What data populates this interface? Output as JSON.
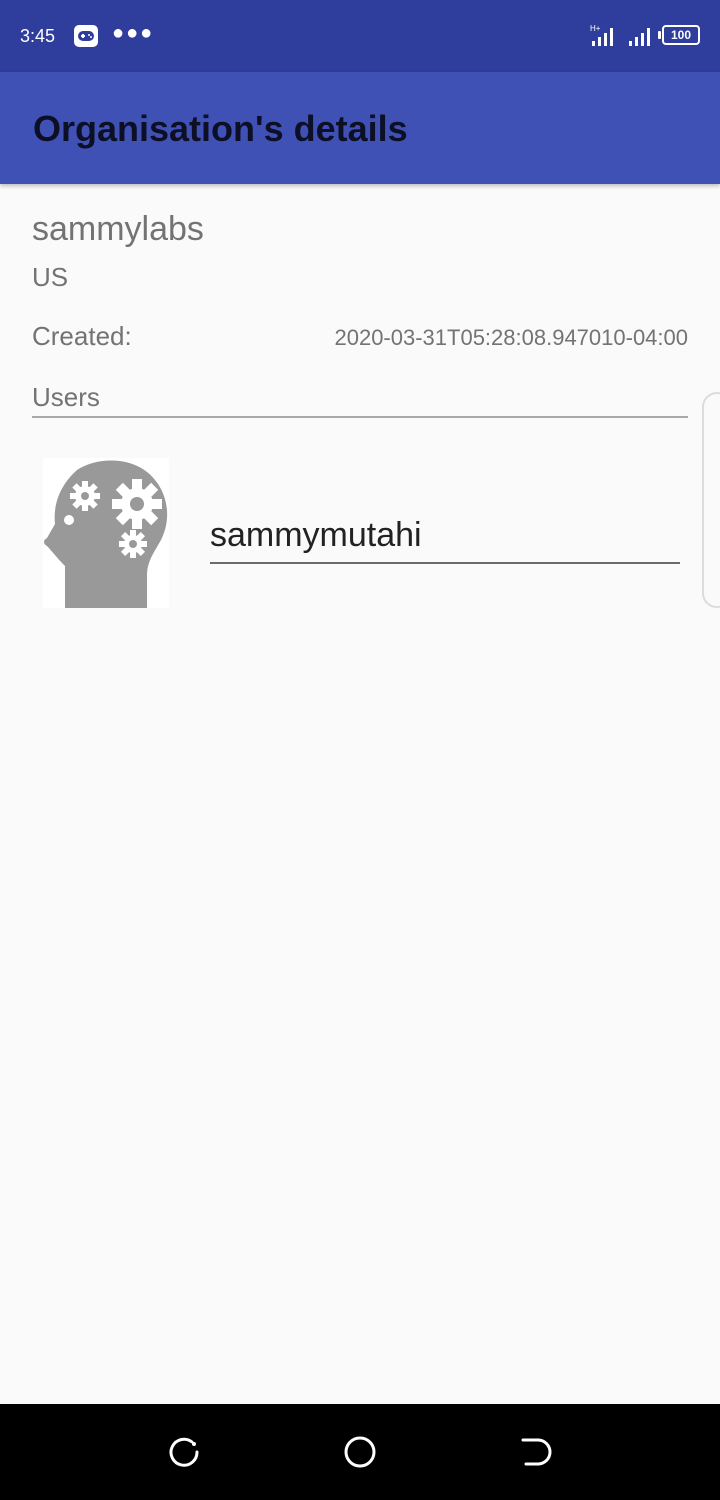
{
  "status_bar": {
    "time": "3:45",
    "battery": "100",
    "icons": [
      "game-icon",
      "more-dots",
      "signal-icon",
      "battery-icon"
    ]
  },
  "app_bar": {
    "title": "Organisation's details"
  },
  "organisation": {
    "name": "sammylabs",
    "country": "US",
    "created_label": "Created:",
    "created_value": "2020-03-31T05:28:08.947010-04:00"
  },
  "users": {
    "label": "Users",
    "items": [
      {
        "username": "sammymutahi",
        "avatar_icon": "head-gears-icon"
      }
    ]
  },
  "nav_bar": {
    "icons": [
      "recent-apps-icon",
      "home-icon",
      "back-icon"
    ]
  },
  "colors": {
    "status_bar": "#2f3d9c",
    "app_bar": "#3f51b5",
    "background": "#fafafa",
    "secondary_text": "#737373"
  }
}
